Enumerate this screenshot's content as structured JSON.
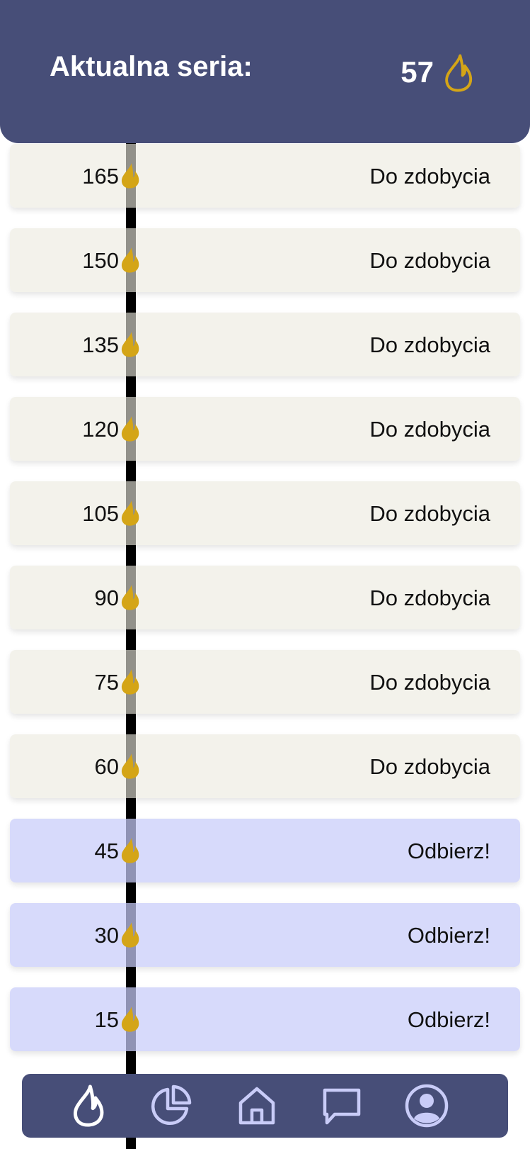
{
  "header": {
    "title": "Aktualna seria:",
    "streak_count": "57",
    "streak_icon": "flame-outline-icon"
  },
  "rewards": [
    {
      "value": "165",
      "status": "Do zdobycia",
      "state": "locked"
    },
    {
      "value": "150",
      "status": "Do zdobycia",
      "state": "locked"
    },
    {
      "value": "135",
      "status": "Do zdobycia",
      "state": "locked"
    },
    {
      "value": "120",
      "status": "Do zdobycia",
      "state": "locked"
    },
    {
      "value": "105",
      "status": "Do zdobycia",
      "state": "locked"
    },
    {
      "value": "90",
      "status": "Do zdobycia",
      "state": "locked"
    },
    {
      "value": "75",
      "status": "Do zdobycia",
      "state": "locked"
    },
    {
      "value": "60",
      "status": "Do zdobycia",
      "state": "locked"
    },
    {
      "value": "45",
      "status": "Odbierz!",
      "state": "claim"
    },
    {
      "value": "30",
      "status": "Odbierz!",
      "state": "claim"
    },
    {
      "value": "15",
      "status": "Odbierz!",
      "state": "claim"
    }
  ],
  "nav": {
    "items": [
      {
        "icon": "flame-icon",
        "active": true
      },
      {
        "icon": "pie-chart-icon",
        "active": false
      },
      {
        "icon": "home-icon",
        "active": false
      },
      {
        "icon": "chat-icon",
        "active": false
      },
      {
        "icon": "profile-icon",
        "active": false
      }
    ]
  },
  "colors": {
    "header_bg": "#474e78",
    "flame": "#d4a517",
    "locked_row": "#f4f3ec",
    "claim_row": "#d8dbfc",
    "nav_icon": "#c9ccf8"
  }
}
